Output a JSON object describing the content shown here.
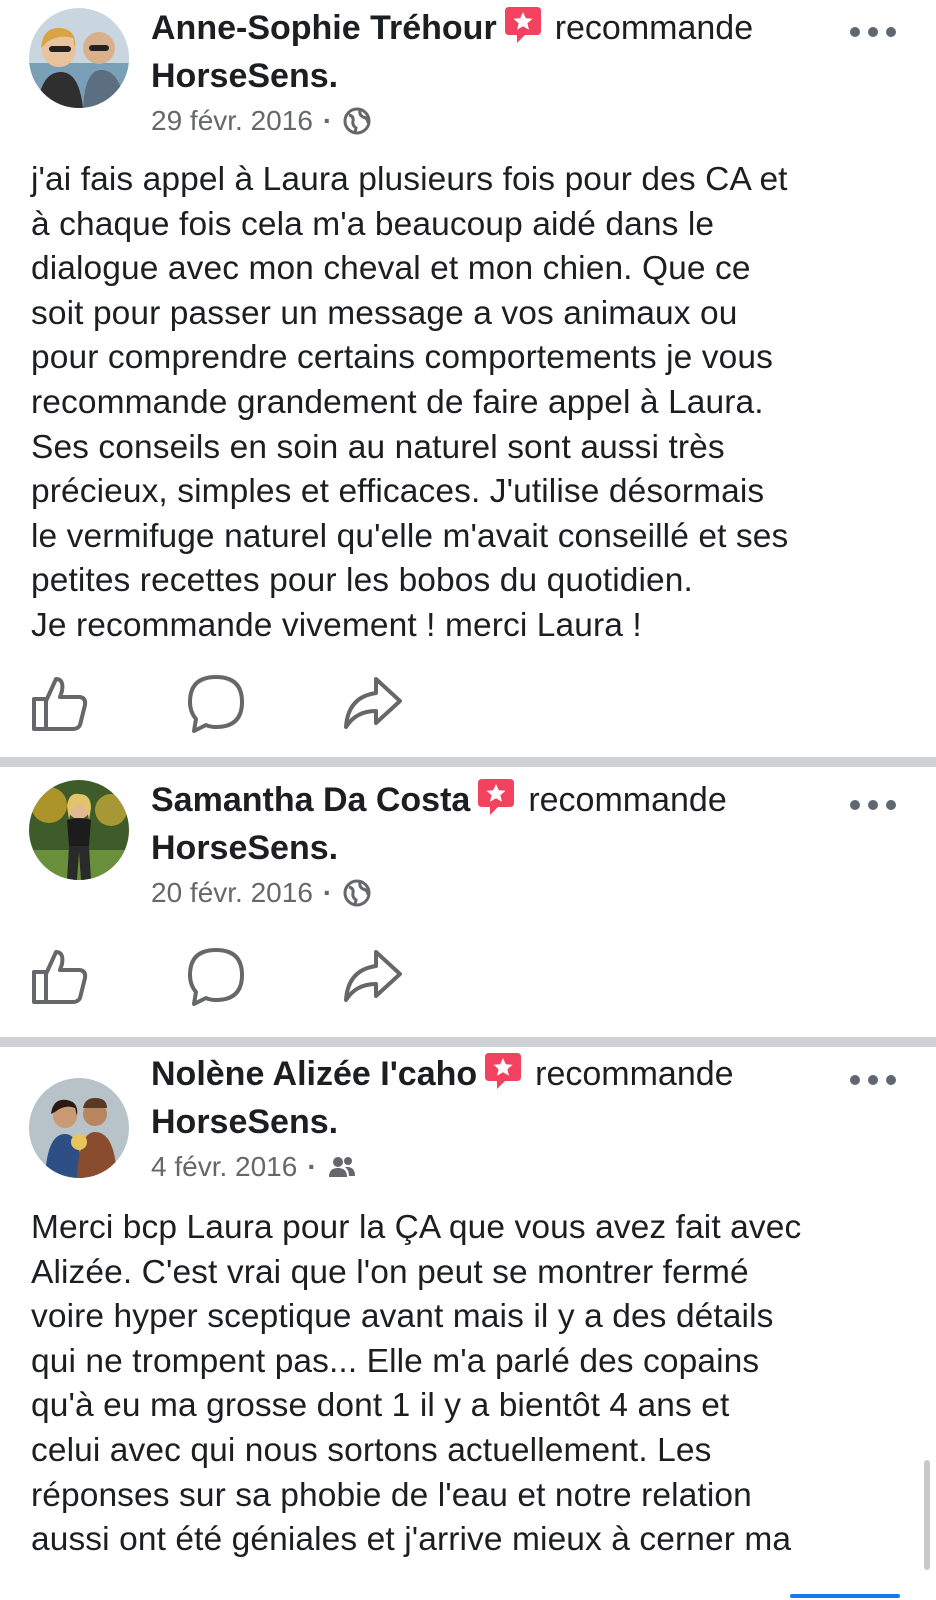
{
  "verb": "recommande",
  "page": "HorseSens.",
  "colors": {
    "badge": "#f3425f",
    "meta": "#65676b",
    "divider": "#ced0d4",
    "icon": "#65676b"
  },
  "posts": [
    {
      "author": "Anne-Sophie Tréhour",
      "date": "29 févr. 2016",
      "audience_icon": "globe-icon",
      "text": "j'ai fais appel à Laura plusieurs fois pour des CA et\nà chaque fois cela m'a beaucoup aidé dans le\ndialogue avec mon cheval et mon chien. Que ce\nsoit pour passer un message a vos animaux ou\npour comprendre certains comportements je vous\nrecommande grandement de faire appel à Laura.\nSes conseils en soin au naturel sont aussi très\nprécieux, simples et efficaces. J'utilise désormais\nle vermifuge naturel qu'elle m'avait conseillé et ses\npetites recettes pour les bobos du quotidien.\nJe recommande vivement ! merci Laura !"
    },
    {
      "author": "Samantha Da Costa",
      "date": "20 févr. 2016",
      "audience_icon": "globe-icon",
      "text": ""
    },
    {
      "author": "Nolène Alizée I'caho",
      "date": "4 févr. 2016",
      "audience_icon": "friends-icon",
      "text": "Merci bcp Laura pour la ÇA que vous avez fait avec\nAlizée. C'est vrai que l'on peut se montrer fermé\nvoire hyper sceptique avant mais il y a des détails\nqui ne trompent pas... Elle m'a parlé des copains\nqu'à eu ma grosse dont 1 il y a bientôt 4 ans et\ncelui avec qui nous sortons actuellement. Les\nréponses sur sa phobie de l'eau et notre relation\naussi ont été géniales et j'arrive mieux à cerner ma"
    }
  ]
}
